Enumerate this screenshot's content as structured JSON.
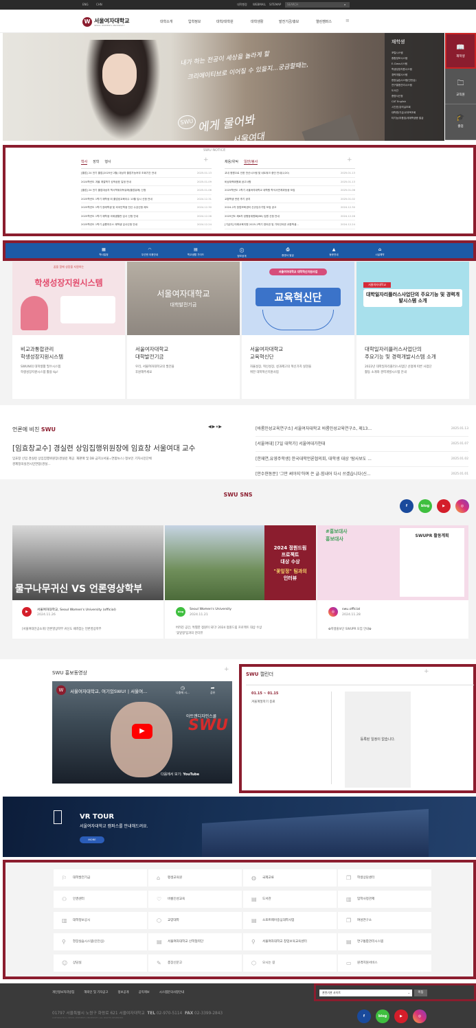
{
  "topbar": {
    "eng": "ENG",
    "chn": "CHN",
    "l1": "대학행정",
    "l2": "WEBMAIL",
    "l3": "SITEMAP",
    "search": "SEARCH"
  },
  "header": {
    "logo": "서울여자대학교",
    "logo_sub": "SEOUL WOMEN'S UNIVERSITY",
    "nav": [
      "대학소개",
      "입학정보",
      "대학/대학원",
      "대학생활",
      "발전기금/홍보",
      "열린캠퍼스"
    ]
  },
  "hero": {
    "line1": "내가 하는 전공이 세상을 놀라게 할",
    "line2": "크리에이티브로 이어질 수 있을지...궁금할때는,",
    "line3": "에게 물어봐",
    "line4": "서울여대",
    "badge": "SWU"
  },
  "quick_panel": {
    "title": "재학생",
    "links": [
      "포털시스템",
      "종합정보시스템",
      "E-Class시스템",
      "학생성장지원시스템",
      "경력개발시스템",
      "현장실습시스템(인턴십)",
      "연구통합관리시스템",
      "도서관",
      "증명서신청",
      "CAT English",
      "시간표/강의실조회",
      "대학원/기금/교과목조회",
      "타기능/부품집/세계학생증 발급"
    ]
  },
  "side_tabs": [
    {
      "label": "재학생",
      "icon": "book-icon"
    },
    {
      "label": "교직원",
      "icon": "briefcase-icon"
    },
    {
      "label": "졸업",
      "icon": "graduation-cap-icon"
    }
  ],
  "notice": {
    "title": "SWU NOTICE",
    "left_tabs": [
      "학사",
      "장학",
      "행사"
    ],
    "left_items": [
      {
        "t": "[졸업] 24 전기 졸업(2025년 2월) 대상자 졸업가능여부 조회기간 안내",
        "d": "2025.01.13"
      },
      {
        "t": "2024학년도 겨울 계절학기 성적공표 일정 안내",
        "d": "2025.01.09"
      },
      {
        "t": "[졸업] 24 전기 졸업대상자 학사학위취득유예(졸업유예) 신청",
        "d": "2025.01.06"
      },
      {
        "t": "2025학년도 1학기 재학생 외 졸업성교육이수 10월 입시 신청 안내",
        "d": "2024.12.31"
      },
      {
        "t": "2025학년도 1학기 장애학생 및 외국인학생 전산 수강신청 제도",
        "d": "2024.12.30"
      },
      {
        "t": "2025학년도 1학기 재학생 국제생활관 입사 신청 안내",
        "d": "2024.12.26"
      },
      {
        "t": "2025학년도 1학기 샬롬하우스 재학생 입사신청 안내",
        "d": "2024.12.24"
      }
    ],
    "right_tabs": [
      "채용/위탁",
      "일반/봉사"
    ],
    "right_items": [
      {
        "t": "교내 청원으로 인한 전산시스템 및 네트워크 중단 안내(1/20)",
        "d": "2025.01.13"
      },
      {
        "t": "비상대책위원회 공고사항",
        "d": "2025.01.13"
      },
      {
        "t": "2025학년도 1학기 서울여자대학교 대학원 학석사연계과정생 모집",
        "d": "2025.01.06"
      },
      {
        "t": "교환학생 관련 후기 공지",
        "d": "2025.01.02"
      },
      {
        "t": "2024-2차 창업보육센터 신규입주기업 모집 공고",
        "d": "2024.12.30"
      },
      {
        "t": "2025년도 제6차 성평등위원회(BB) 임원 신청 안내",
        "d": "2024.12.26"
      },
      {
        "t": "[기금지] 미래교육지원 2025-2학기 영어권 및 기타언어권 교환학생...",
        "d": "2024.12.24"
      }
    ]
  },
  "quick_menu": [
    {
      "label": "학사일정",
      "icon": "calendar-icon"
    },
    {
      "label": "무선랜 이용안내",
      "icon": "wifi-icon"
    },
    {
      "label": "학교생활 가이드",
      "icon": "guide-book-icon"
    },
    {
      "label": "정보공개",
      "icon": "info-icon"
    },
    {
      "label": "증명서 발급",
      "icon": "printer-icon"
    },
    {
      "label": "동문안내",
      "icon": "graduation-cap-icon"
    },
    {
      "label": "시설예약",
      "icon": "building-icon"
    }
  ],
  "cards": [
    {
      "img_title": "학생성장지원시스템",
      "img_sub": "꿈을 함께 성장을 지원하는",
      "title1": "비교과통합관리",
      "title2": "학생성장지원시스템",
      "desc1": "SWUNI의 대학생활 필수시스템",
      "desc2": "학생성장지원시스템 활용 tip!"
    },
    {
      "img_title": "서울여자대학교",
      "img_sub": "대학발전기금",
      "title1": "서울여자대학교",
      "title2": "대학발전기금",
      "desc1": "우리, 서울여자대학교의 발전을",
      "desc2": "후원해주세요"
    },
    {
      "img_title": "교육혁신단",
      "img_sub": "서울여자대학교 대학혁신지원사업",
      "title1": "서울여자대학교",
      "title2": "교육혁신단",
      "desc1": "자율성장, 혁신성장, 성과제고의 혁신가치 실현을",
      "desc2": "위한 대학혁신지원사업"
    },
    {
      "img_title": "대학일자리플러스사업단의 주요기능 및 경력개발시스템 소개",
      "img_sub": "서울여자대학교",
      "title1": "대학일자리플러스사업단의",
      "title2": "주요기능 및 경력개발시스템 소개",
      "desc1": "2022년 대학일자리플러스사업단 선정에 따른 사업단",
      "desc2": "활동 소개와 경력개발시스템 안내"
    }
  ],
  "press": {
    "heading": "언론에 비친",
    "heading_em": "SWU",
    "headline": "[임효창교수] 경실련 상임집행위원장에 임효창 서울여대 교수",
    "summary1": "임효창 신임 경실련 상임집행위원장(경실련 제공. 재판매 및 DB 금지)(서울=연합뉴스) 정보인 기자시민단체",
    "summary2": "경제정의실천시민연합(경실...",
    "items": [
      {
        "t": "[바롬인성교육연구소] 서울여자대학교 바롬인성교육연구소, 제13...",
        "d": "2025.01.13"
      },
      {
        "t": "[서울여대] [7일 대학가] 서울여대가천대",
        "d": "2025.01.07"
      },
      {
        "t": "[한재연,유영주학생] 한국대학언론협의회, 대학생 대상 '탐사보도 ...",
        "d": "2025.01.02"
      },
      {
        "t": "[안수현동문] '그만 써야지'하며 쓴 글-힘내어 다시 쓰겠습니다(신...",
        "d": "2025.01.01"
      }
    ]
  },
  "sns": {
    "heading": "SWU SNS",
    "posts": [
      {
        "img": "물구나무귀신 VS 언론영상학부",
        "account": "서울여자대학교, Seoul Women's University (official)",
        "date": "2024.11.26",
        "desc": "[서울여대전공소개] 언론영상학부 귀신도 때려잡는 언론영상학부",
        "icon": "youtube-icon"
      },
      {
        "img_l1": "2024 정원드림",
        "img_l2": "프로젝트",
        "img_l3": "대상 수상",
        "img_l4": "\"꽃잎정\" 팀과의",
        "img_l5": "인터뷰",
        "account": "Seoul Women's University",
        "date": "2024.11.21",
        "desc1": "버려진 공간, 특별한 정원이 되다! 2024 정원드림 프로젝트 대상 수상",
        "desc2": "'꽃잎정'팀과의 인터뷰",
        "icon": "blog-icon"
      },
      {
        "img_l1": "#홍보대사",
        "img_l2": "홍보대사",
        "img_l3": "SWUPR 활동계획",
        "account": "swu.official",
        "date": "2024.11.28",
        "desc": "✿학생홍보단 SWUPR 모집 안내✿",
        "icon": "instagram-icon"
      }
    ]
  },
  "promo": {
    "heading": "SWU 홍보동영상",
    "video_title": "서울여자대학교, 여기있SWU! | 서울여...",
    "watch_later": "나중에 시...",
    "share": "공유",
    "watch_on": "다음에서 보기:",
    "yt": "YouTube",
    "brand1": "아트앤디자인스쿨",
    "brand2": "SWU"
  },
  "calendar": {
    "heading_em": "SWU",
    "heading": "캘린더",
    "range": "01.15 ~ 01.15",
    "event": "겨울계절학기 종료",
    "empty": "등록된 일정이 없습니다."
  },
  "vr": {
    "title": "VR TOUR",
    "desc": "서울여자대학교 캠퍼스를 안내해드려요.",
    "more": "MORE"
  },
  "links": [
    [
      "대학발전기금",
      "평생교육원",
      "국제교류",
      "학생상담센터"
    ],
    [
      "인권센터",
      "바롬인성교육",
      "도서관",
      "입학사정관제"
    ],
    [
      "대학정보공시",
      "교양대학",
      "소프트웨어중심대학사업",
      "여성연구소"
    ],
    [
      "현장실습시스템(인턴십)",
      "서울여자대학교 산학협력단",
      "서울여자대학교 창업보육교육센터",
      "연구통합관리시스템"
    ],
    [
      "상담실",
      "총장신문고",
      "오시는 길",
      "원격지원서비스"
    ]
  ],
  "footer": {
    "links": [
      "개인정보처리방침",
      "해외인 및 기자공고",
      "정보공개",
      "공익제보",
      "시스템문의사항안내"
    ],
    "select": "관련기관 사이트",
    "go": "이동",
    "address": "01797 서울특별시 노원구 화랑로 621 서울여자대학교",
    "tel_l": "TEL",
    "tel": "02-970-5114",
    "fax_l": "FAX",
    "fax": "02-3399-2843",
    "copy": "COPYRIGHT(C) SEOUL WOMEN'S UNIVERSITY. ALL RIGHTS RESERVED."
  }
}
